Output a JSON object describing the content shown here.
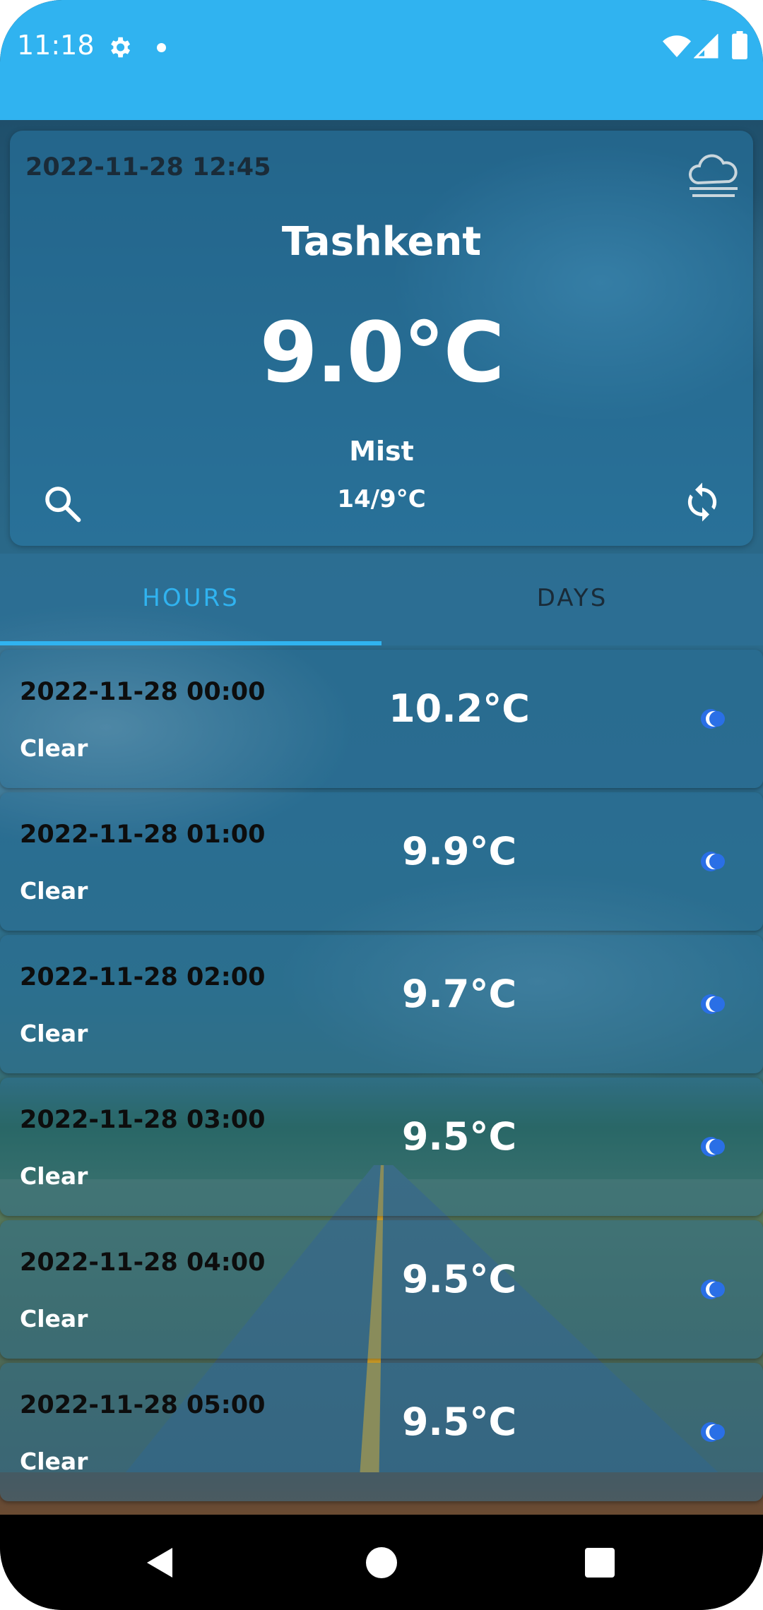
{
  "status_bar": {
    "time": "11:18",
    "background_color": "#30b3f0",
    "icons": [
      "gear-icon",
      "dot-icon",
      "wifi-icon",
      "signal-icon",
      "battery-icon"
    ]
  },
  "header": {
    "datetime": "2022-11-28 12:45",
    "weather_icon": "cloud-fog-icon",
    "city": "Tashkent",
    "temperature": "9.0°C",
    "condition": "Mist",
    "range": "14/9°C",
    "search_icon": "search-icon",
    "refresh_icon": "refresh-icon"
  },
  "tabs": {
    "items": [
      {
        "label": "HOURS",
        "selected": true
      },
      {
        "label": "DAYS",
        "selected": false
      }
    ],
    "accent_color": "#30b3f0"
  },
  "hours": [
    {
      "time": "2022-11-28 00:00",
      "condition": "Clear",
      "temp": "10.2°C",
      "icon": "moon-icon"
    },
    {
      "time": "2022-11-28 01:00",
      "condition": "Clear",
      "temp": "9.9°C",
      "icon": "moon-icon"
    },
    {
      "time": "2022-11-28 02:00",
      "condition": "Clear",
      "temp": "9.7°C",
      "icon": "moon-icon"
    },
    {
      "time": "2022-11-28 03:00",
      "condition": "Clear",
      "temp": "9.5°C",
      "icon": "moon-icon"
    },
    {
      "time": "2022-11-28 04:00",
      "condition": "Clear",
      "temp": "9.5°C",
      "icon": "moon-icon"
    },
    {
      "time": "2022-11-28 05:00",
      "condition": "Clear",
      "temp": "9.5°C",
      "icon": "moon-icon"
    }
  ],
  "nav_bar": {
    "icons": [
      "back-icon",
      "home-icon",
      "recents-icon"
    ]
  }
}
